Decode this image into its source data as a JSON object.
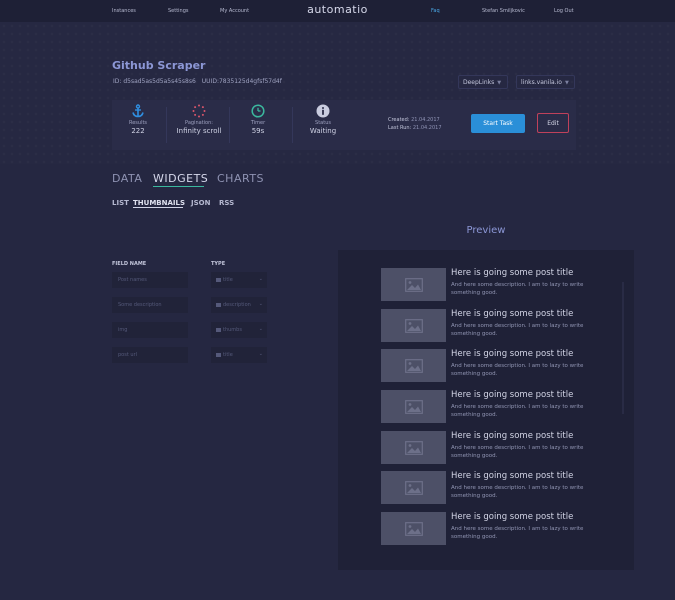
{
  "nav": {
    "instances": "Instances",
    "settings": "Settings",
    "account": "My Account",
    "logo": "automatio",
    "faq": "Faq",
    "user": "Stefan Smiljkovic",
    "logout": "Log Out"
  },
  "scraper": {
    "title": "Github Scraper",
    "id": "ID: d5sad5as5d5a5s45s8s6",
    "uuid": "UUID:7835125d4gfsf57d4f"
  },
  "dropdowns": {
    "deeplinks": "DeepLinks",
    "links": "links.vanila.io"
  },
  "stats": [
    {
      "icon": "anchor-icon",
      "label": "Results",
      "value": "222"
    },
    {
      "icon": "spinner-icon",
      "label": "Pagination:",
      "value": "Infinity scroll"
    },
    {
      "icon": "clock-icon",
      "label": "Timer",
      "value": "59s"
    },
    {
      "icon": "info-icon",
      "label": "Status",
      "value": "Waiting"
    }
  ],
  "dates": {
    "created_label": "Created:",
    "created": "21.04.2017",
    "lastrun_label": "Last Run:",
    "lastrun": "21.04.2017"
  },
  "actions": {
    "start": "Start Task",
    "edit": "Edit"
  },
  "colors": {
    "accent": "#2a8fd8",
    "edit_border": "#c0415b",
    "tab_underline": "#3bb89e",
    "title": "#8c97d6"
  },
  "tabs": [
    "DATA",
    "WIDGETS",
    "CHARTS"
  ],
  "subtabs": [
    "LIST",
    "THUMBNAILS",
    "JSON",
    "RSS"
  ],
  "form": {
    "field_head": "FIELD NAME",
    "type_head": "TYPE",
    "rows": [
      {
        "field": "Post names",
        "type": "title"
      },
      {
        "field": "Some description",
        "type": "description"
      },
      {
        "field": "img",
        "type": "thumbs"
      },
      {
        "field": "post url",
        "type": "title"
      }
    ]
  },
  "preview": {
    "title": "Preview",
    "post_title": "Here is going some post title",
    "post_desc": "And here some description. I am to lazy to write something good."
  }
}
